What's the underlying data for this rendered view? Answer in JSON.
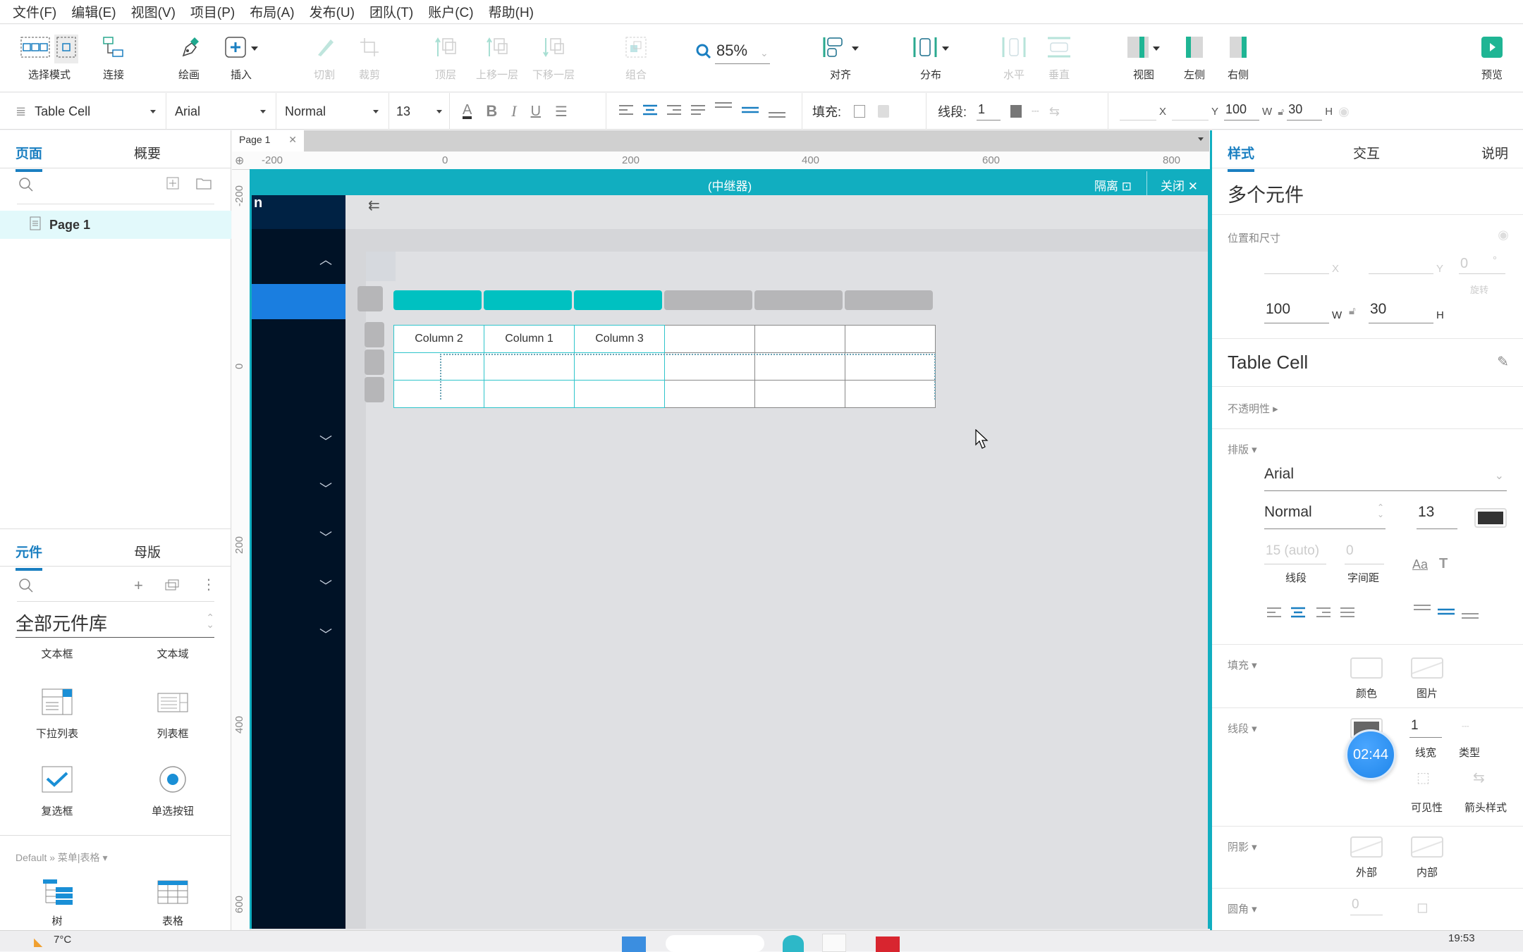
{
  "menubar": [
    "文件(F)",
    "编辑(E)",
    "视图(V)",
    "项目(P)",
    "布局(A)",
    "发布(U)",
    "团队(T)",
    "账户(C)",
    "帮助(H)"
  ],
  "toolbar": {
    "select_mode": "选择模式",
    "connect": "连接",
    "draw": "绘画",
    "insert": "插入",
    "cut": "切割",
    "crop": "裁剪",
    "top_layer": "顶层",
    "move_up": "上移一层",
    "move_down": "下移一层",
    "group": "组合",
    "zoom": "85%",
    "align": "对齐",
    "distribute": "分布",
    "horizontal": "水平",
    "vertical": "垂直",
    "view": "视图",
    "left": "左侧",
    "right": "右侧",
    "preview": "预览"
  },
  "format": {
    "style": "Table Cell",
    "font": "Arial",
    "weight": "Normal",
    "size": "13",
    "fill_label": "填充:",
    "line_label": "线段:",
    "line_width": "1",
    "x": "",
    "y": "",
    "w": "100",
    "h": "30",
    "x_label": "X",
    "y_label": "Y",
    "w_label": "W",
    "h_label": "H"
  },
  "left_panel": {
    "tabs": [
      "页面",
      "概要"
    ],
    "pages": [
      "Page 1"
    ],
    "widget_tabs": [
      "元件",
      "母版"
    ],
    "library": "全部元件库",
    "widgets": [
      "文本框",
      "文本域",
      "下拉列表",
      "列表框",
      "复选框",
      "单选按钮"
    ],
    "group_label": "Default » 菜单|表格 ▾",
    "group_widgets": [
      "树",
      "表格"
    ]
  },
  "canvas": {
    "page_tab": "Page 1",
    "ruler_h": [
      "-200",
      "0",
      "200",
      "400",
      "600",
      "800"
    ],
    "ruler_v": [
      "-200",
      "0",
      "200",
      "400",
      "600"
    ],
    "repeater_title": "(中继器)",
    "isolate": "隔离",
    "close": "关闭",
    "sidebar_letter": "n",
    "table_headers": [
      "Column 2",
      "Column 1",
      "Column 3",
      "",
      "",
      ""
    ],
    "table_rows": 2,
    "accent": "#11aec0",
    "header_bar_active": "#00c1c1",
    "header_bar_inactive": "#b6b6b8"
  },
  "right_panel": {
    "tabs": [
      "样式",
      "交互",
      "说明"
    ],
    "title": "多个元件",
    "pos_size": "位置和尺寸",
    "x": "",
    "y": "",
    "rotation": "0",
    "rotation_label": "旋转",
    "w": "100",
    "h": "30",
    "x_label": "X",
    "y_label": "Y",
    "w_label": "W",
    "h_label": "H",
    "style_name": "Table Cell",
    "opacity": "不透明性 ▸",
    "typography": "排版 ▾",
    "font": "Arial",
    "weight": "Normal",
    "size": "13",
    "font_color": "#333333",
    "line_spacing": "15 (auto)",
    "line_spacing_label": "线段",
    "letter_spacing": "0",
    "letter_spacing_label": "字间距",
    "fill": "填充 ▾",
    "fill_color": "颜色",
    "fill_image": "图片",
    "border": "线段 ▾",
    "border_width": "1",
    "border_width_label": "线宽",
    "border_type": "类型",
    "visibility": "可见性",
    "arrow_style": "箭头样式",
    "shadow": "阴影 ▾",
    "shadow_outer": "外部",
    "shadow_inner": "内部",
    "radius": "圆角 ▾",
    "radius_value": "0"
  },
  "overlay": {
    "timer": "02:44"
  },
  "taskbar": {
    "weather": "7°C",
    "clock": "19:53"
  }
}
